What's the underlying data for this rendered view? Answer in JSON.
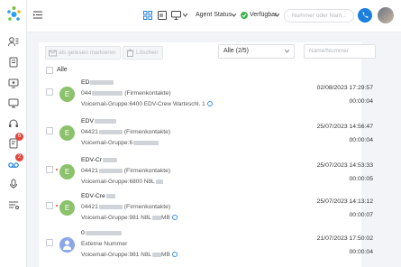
{
  "sidebar": {
    "badges": [
      "6",
      "2"
    ]
  },
  "topbar": {
    "agent_status": "Agent Status",
    "availability": "Verfügbar",
    "search_placeholder": "Nummer oder Nam..."
  },
  "toolbar": {
    "mark_read": "als gelesen markieren",
    "delete": "Löschen",
    "filter_value": "Alle  (2/5)",
    "search_placeholder": "Name/Nummer",
    "select_all": "Alle"
  },
  "rows": [
    {
      "avatar": "E",
      "name": "ED",
      "number": "044",
      "type": "(Firmenkontakte)",
      "group": "Voicemail-Gruppe:6400 EDV-Crew Warteschl. 1",
      "date": "02/08/2023 17:29:57",
      "duration": "00:00:04"
    },
    {
      "avatar": "E",
      "name": "EDV",
      "number": "04421",
      "type": "(Firmenkontakte)",
      "group": "Voicemail-Gruppe:6",
      "date": "25/07/2023 14:56:47",
      "duration": "00:00:04"
    },
    {
      "avatar": "E",
      "name": "EDV-Cr",
      "number": "04421",
      "type": "(Firmenkontakte)",
      "group": "Voicemail-Gruppe:6800 N8L",
      "date": "25/07/2023 14:53:33",
      "duration": "00:00:05"
    },
    {
      "avatar": "E",
      "name": "EDV-Cre",
      "number": "04421",
      "type": "(Firmenkontakte)",
      "group": "Voicemail-Gruppe:981 N8L",
      "group_suffix": "MB",
      "date": "25/07/2023 14:13:12",
      "duration": "00:00:07"
    },
    {
      "avatar": "",
      "name": "0",
      "number": "Externe Nummer",
      "type": "",
      "group": "Voicemail-Gruppe:981 N8L",
      "group_suffix": "MB",
      "date": "21/07/2023 17:50:02",
      "duration": "00:00:04"
    }
  ],
  "colors": {
    "accent": "#1c7fe0",
    "avatar_green": "#8cc26b",
    "avatar_blue": "#8aa7e8",
    "badge_red": "#e5453c"
  }
}
